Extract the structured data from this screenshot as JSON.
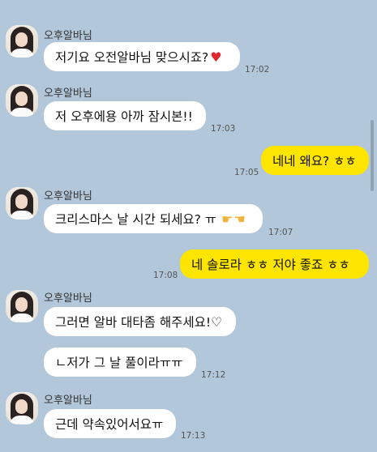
{
  "sender": "오후알바님",
  "messages": [
    {
      "text": "저기요 오전알바님 맞으시죠?",
      "emoji": "heart-emoji",
      "time": "17:02"
    },
    {
      "text": "저 오후에용 아까 잠시본!!",
      "time": "17:03"
    },
    {
      "text": "네네 왜요? ㅎㅎ",
      "time": "17:05"
    },
    {
      "text": "크리스마스 날 시간 되세요? ㅠ",
      "emoji": "pointing-hands-emoji",
      "time": "17:07"
    },
    {
      "text": "네 솔로라 ㅎㅎ 저야 좋죠 ㅎㅎ",
      "time": "17:08"
    },
    {
      "text": "그러면 알바 대타좀 해주세요!♡"
    },
    {
      "text": "ㄴ저가 그 날 풀이라ㅠㅠ",
      "time": "17:12"
    },
    {
      "text": "근데 약속있어서요ㅠ",
      "time": "17:13"
    }
  ],
  "colors": {
    "background": "#b2c7d9",
    "incoming": "#ffffff",
    "outgoing": "#fee500"
  }
}
